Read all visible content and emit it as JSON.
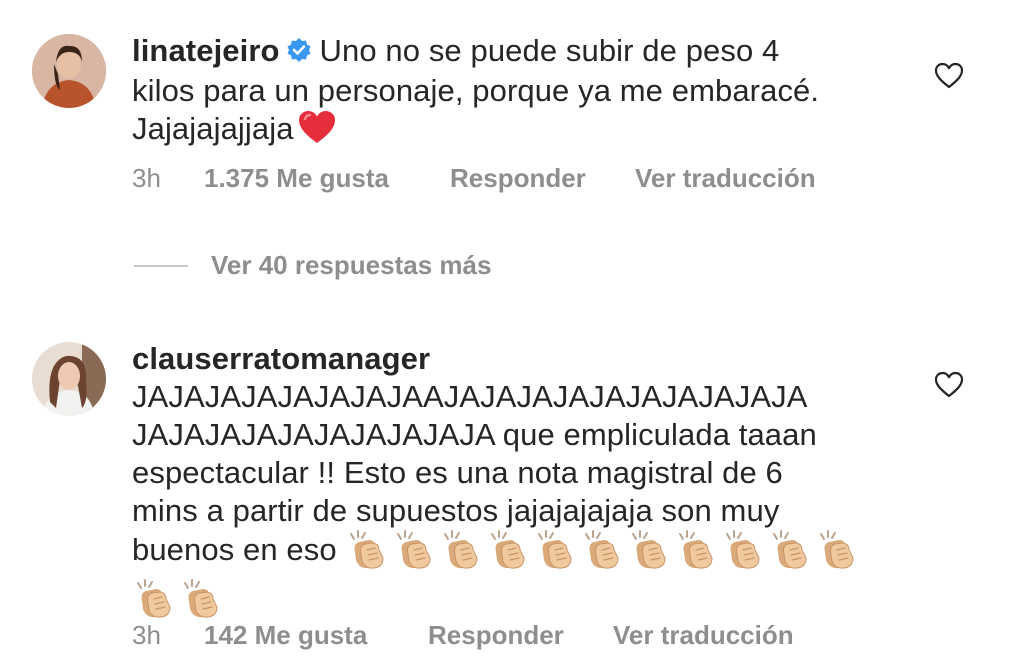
{
  "comments": [
    {
      "username": "linatejeiro",
      "verified": true,
      "text_lines": [
        "Uno no se puede subir de peso 4",
        "kilos para un personaje, porque ya me embaracé.",
        "Jajajajajjaja"
      ],
      "emoji": "red-heart",
      "time": "3h",
      "likes": "1.375 Me gusta",
      "reply": "Responder",
      "translate": "Ver traducción",
      "view_replies": "Ver 40 respuestas más"
    },
    {
      "username": "clauserratomanager",
      "verified": false,
      "text_lines": [
        "JAJAJAJAJAJAJAJAAJAJAJAJAJAJAJAJAJAJA",
        "JAJAJAJAJAJAJAJAJAJA que empliculada taaan",
        "espectacular !! Esto es una nota magistral de 6",
        "mins a partir de supuestos jajajajajaja son muy",
        "buenos en eso"
      ],
      "emoji": "clapping-hands",
      "emoji_count": 13,
      "time": "3h",
      "likes": "142 Me gusta",
      "reply": "Responder",
      "translate": "Ver traducción"
    }
  ],
  "colors": {
    "text": "#262626",
    "secondary": "#8e8e8e",
    "verified": "#3897f0",
    "heart": "#e0245e"
  }
}
